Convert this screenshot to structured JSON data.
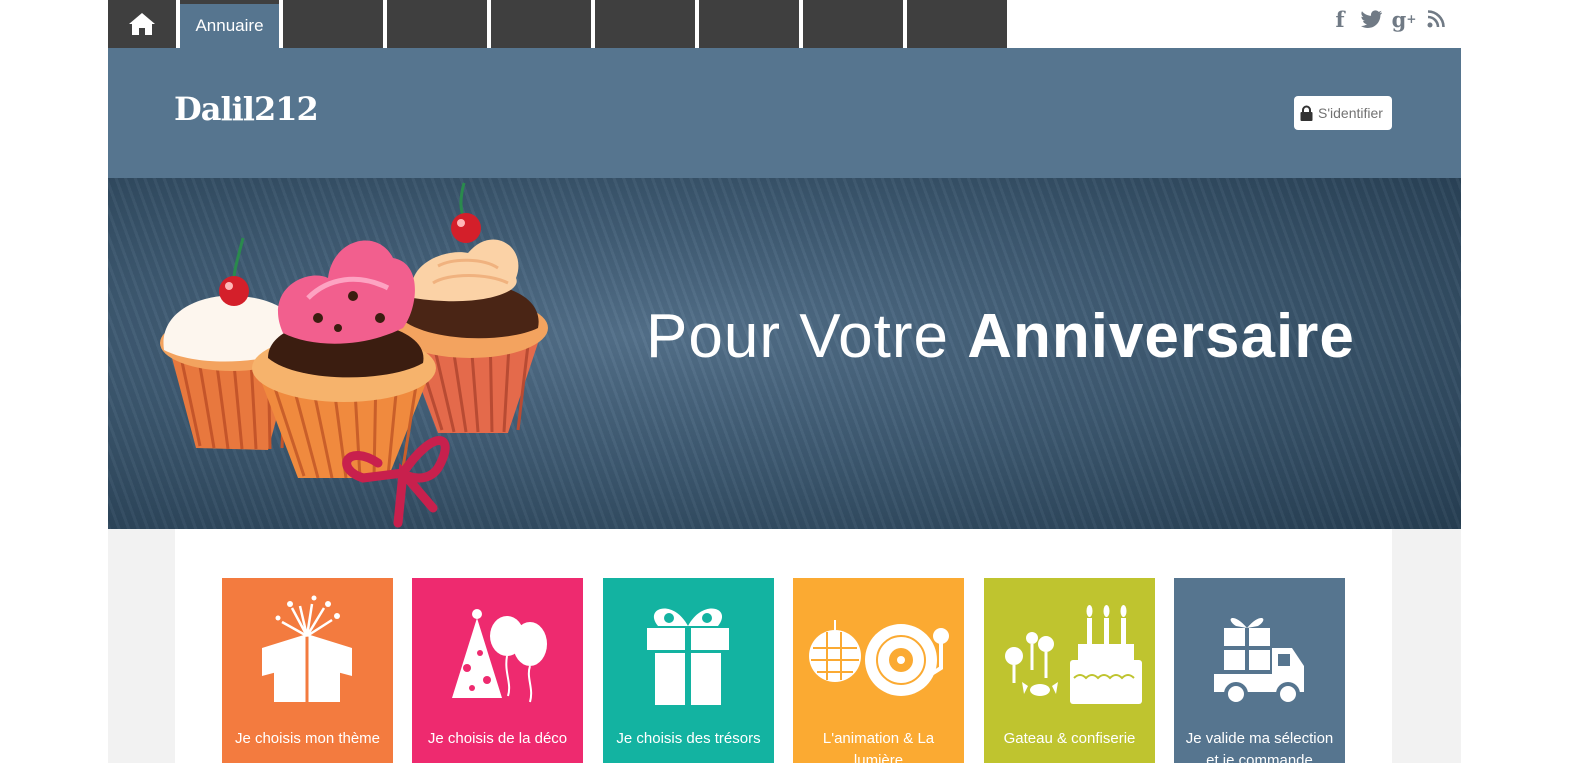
{
  "nav": {
    "items": [
      {
        "label": "Annuaire",
        "active": true
      }
    ]
  },
  "social": {
    "icons": [
      "facebook-icon",
      "twitter-icon",
      "google-plus-icon",
      "rss-icon"
    ]
  },
  "header": {
    "logo": "Dalil212",
    "login_label": "S'identifier"
  },
  "banner": {
    "text_light": "Pour Votre ",
    "text_bold": "Anniversaire"
  },
  "tiles": [
    {
      "label": "Je choisis mon thème",
      "color": "#f37b3f",
      "icon": "gift-box-open-icon"
    },
    {
      "label": "Je choisis de la déco",
      "color": "#ee2a6f",
      "icon": "party-hat-balloons-icon"
    },
    {
      "label": "Je choisis des trésors",
      "color": "#13b3a1",
      "icon": "gift-icon"
    },
    {
      "label": "L'animation & La lumière",
      "color": "#fbaa32",
      "icon": "disco-turntable-icon"
    },
    {
      "label": "Gateau & confiserie",
      "color": "#bfc42f",
      "icon": "cake-candy-icon"
    },
    {
      "label": "Je valide ma sélection et je commande",
      "color": "#56758f",
      "icon": "delivery-truck-icon"
    }
  ],
  "colors": {
    "nav_bg": "#3f3f3f",
    "brand": "#56758f"
  }
}
